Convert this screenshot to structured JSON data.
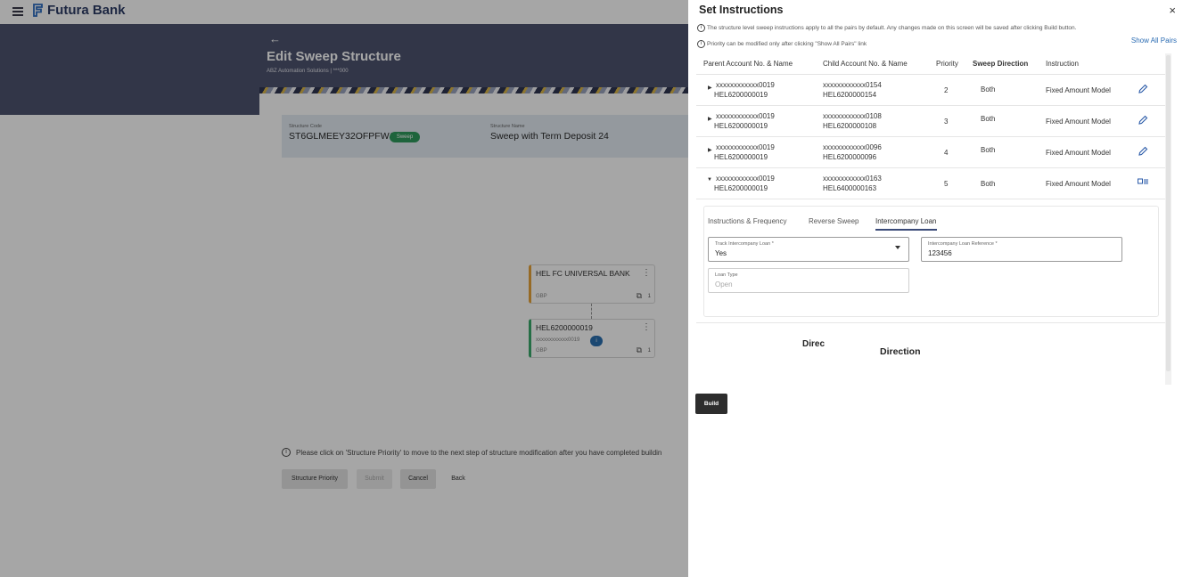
{
  "app": {
    "brand": "Futura Bank"
  },
  "page": {
    "title": "Edit Sweep Structure",
    "subtitle": "ABZ Automation Solutions | ***000"
  },
  "summary": {
    "code_label": "Structure Code",
    "code_value": "ST6GLMEEY32OFPFWJ",
    "code_badge": "Sweep",
    "name_label": "Structure Name",
    "name_value": "Sweep with Term Deposit 24"
  },
  "tree": {
    "node1": {
      "title": "HEL FC UNIVERSAL BANK",
      "currency": "GBP",
      "count": "1"
    },
    "node2": {
      "title": "HEL6200000019",
      "sub": "xxxxxxxxxxxx0019",
      "badge": "i",
      "currency": "GBP",
      "count": "1"
    }
  },
  "footer": {
    "info": "Please click on 'Structure Priority' to move to the next step of structure modification after you have completed buildin",
    "priority_label": "Structure Priority",
    "submit_label": "Submit",
    "cancel_label": "Cancel",
    "back_label": "Back"
  },
  "drawer": {
    "title": "Set Instructions",
    "close": "×",
    "note1": "The structure level sweep instructions apply to all the pairs by default. Any changes made on this screen will be saved after clicking Build button.",
    "note2": "Priority can be modified only after clicking \"Show All Pairs\" link",
    "show_all": "Show All Pairs",
    "columns": {
      "parent": "Parent Account No. & Name",
      "child": "Child Account No. & Name",
      "priority": "Priority",
      "direction": "Sweep Direction",
      "instruction": "Instruction"
    },
    "rows": [
      {
        "parent_acc": "xxxxxxxxxxxx0019",
        "parent_name": "HEL6200000019",
        "child_acc": "xxxxxxxxxxxx0154",
        "child_name": "HEL6200000154",
        "priority": "2",
        "direction": "Both",
        "instruction": "Fixed Amount Model",
        "expanded": false
      },
      {
        "parent_acc": "xxxxxxxxxxxx0019",
        "parent_name": "HEL6200000019",
        "child_acc": "xxxxxxxxxxxx0108",
        "child_name": "HEL6200000108",
        "priority": "3",
        "direction": "Both",
        "instruction": "Fixed Amount Model",
        "expanded": false
      },
      {
        "parent_acc": "xxxxxxxxxxxx0019",
        "parent_name": "HEL6200000019",
        "child_acc": "xxxxxxxxxxxx0096",
        "child_name": "HEL6200000096",
        "priority": "4",
        "direction": "Both",
        "instruction": "Fixed Amount Model",
        "expanded": false
      },
      {
        "parent_acc": "xxxxxxxxxxxx0019",
        "parent_name": "HEL6200000019",
        "child_acc": "xxxxxxxxxxxx0163",
        "child_name": "HEL6400000163",
        "priority": "5",
        "direction": "Both",
        "instruction": "Fixed Amount Model",
        "expanded": true
      }
    ],
    "tabs": [
      {
        "label": "Instructions & Frequency",
        "active": false
      },
      {
        "label": "Reverse Sweep",
        "active": false
      },
      {
        "label": "Intercompany Loan",
        "active": true
      }
    ],
    "fields": {
      "track_label": "Track Intercompany Loan *",
      "track_value": "Yes",
      "ref_label": "Intercompany Loan Reference *",
      "ref_value": "123456",
      "loan_type_label": "Loan Type",
      "loan_type_placeholder": "Open"
    },
    "direc_short": "Direc",
    "direction_text": "Direction",
    "build_label": "Build"
  },
  "icons": {
    "menu": "hamburger-icon",
    "close": "close-icon",
    "info": "info-icon",
    "edit": "pencil-icon",
    "expanded_edit": "card-list-icon",
    "hierarchy": "hierarchy-icon"
  }
}
